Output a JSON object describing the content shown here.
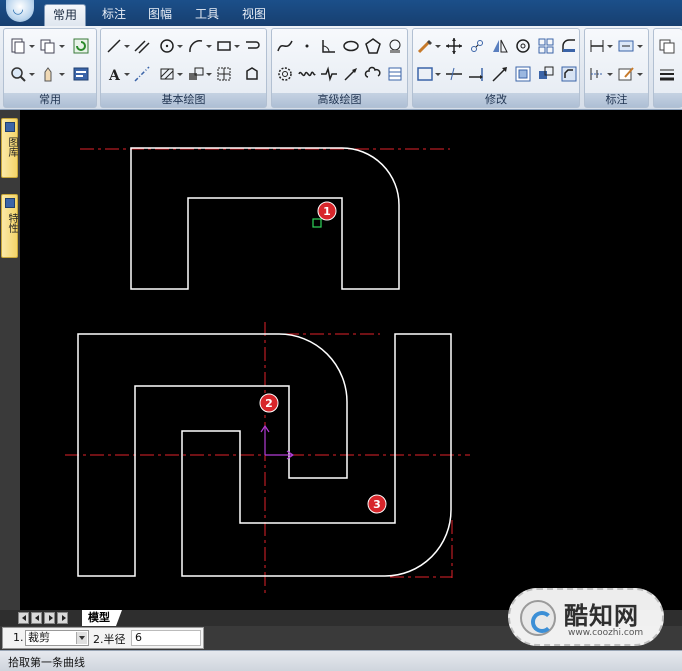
{
  "tabs": [
    {
      "label": "常用",
      "active": true
    },
    {
      "label": "标注",
      "active": false
    },
    {
      "label": "图幅",
      "active": false
    },
    {
      "label": "工具",
      "active": false
    },
    {
      "label": "视图",
      "active": false
    }
  ],
  "ribbon": {
    "groups": [
      "常用",
      "基本绘图",
      "高级绘图",
      "修改",
      "标注"
    ]
  },
  "side_palette": {
    "tabs": [
      "图库",
      "特性"
    ]
  },
  "drawing": {
    "markers": [
      "1",
      "2",
      "3"
    ],
    "colors": {
      "background": "#000000",
      "geometry": "#ffffff",
      "centerline": "#e0222a",
      "ucs": "#b23cd6",
      "cursor": "#2fd45a",
      "marker": "#d7262b"
    }
  },
  "layout_tabs": {
    "model_label": "模型"
  },
  "command": {
    "option1_index": "1.",
    "option1_value": "裁剪",
    "option2_label": "2.半径",
    "option2_value": "6"
  },
  "status": {
    "prompt": "拾取第一条曲线"
  },
  "watermark": {
    "title": "酷知网",
    "url": "www.coozhi.com"
  }
}
